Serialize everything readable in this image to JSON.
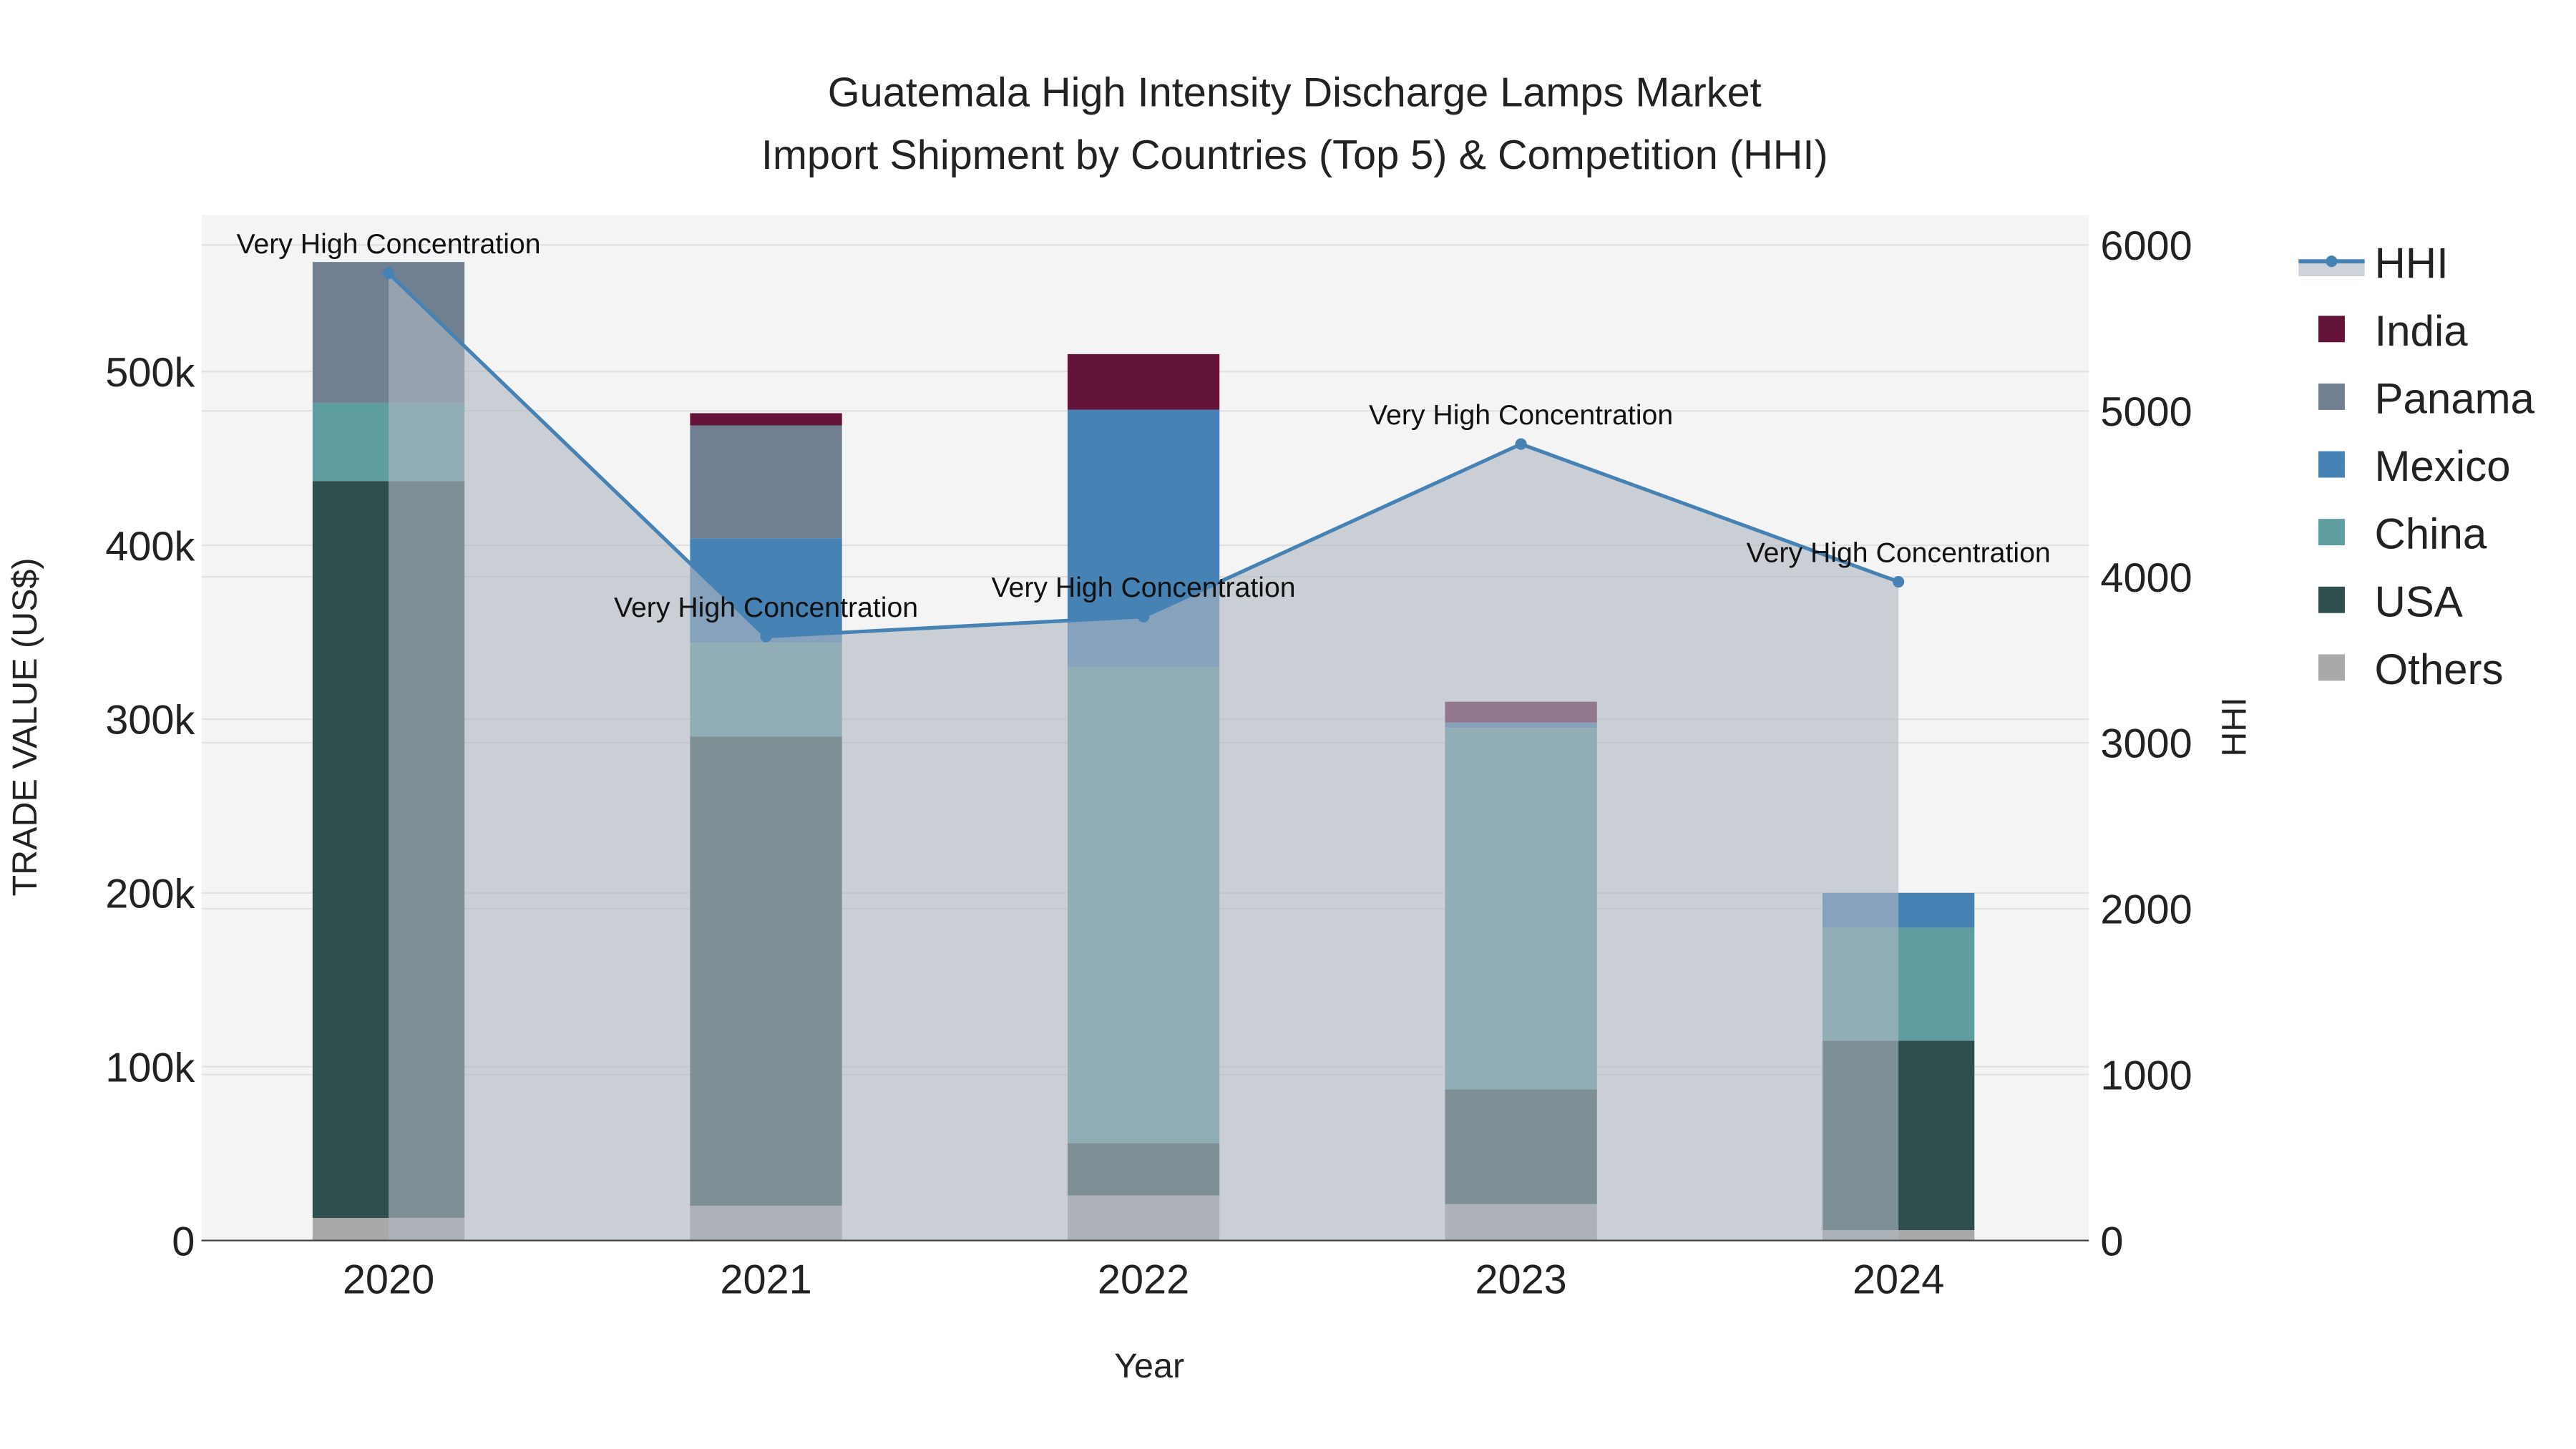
{
  "chart_data": {
    "type": "bar",
    "title_line1": "Guatemala High Intensity Discharge Lamps Market",
    "title_line2": "Import Shipment by Countries (Top 5) & Competition (HHI)",
    "xlabel": "Year",
    "ylabel": "TRADE VALUE (US$)",
    "y2label": "HHI",
    "categories": [
      "2020",
      "2021",
      "2022",
      "2023",
      "2024"
    ],
    "ylim": [
      0,
      590000
    ],
    "y2lim": [
      0,
      6180
    ],
    "yticks": [
      {
        "v": 0,
        "label": "0"
      },
      {
        "v": 100000,
        "label": "100k"
      },
      {
        "v": 200000,
        "label": "200k"
      },
      {
        "v": 300000,
        "label": "300k"
      },
      {
        "v": 400000,
        "label": "400k"
      },
      {
        "v": 500000,
        "label": "500k"
      }
    ],
    "y2ticks": [
      {
        "v": 0,
        "label": "0"
      },
      {
        "v": 1000,
        "label": "1000"
      },
      {
        "v": 2000,
        "label": "2000"
      },
      {
        "v": 3000,
        "label": "3000"
      },
      {
        "v": 4000,
        "label": "4000"
      },
      {
        "v": 5000,
        "label": "5000"
      },
      {
        "v": 6000,
        "label": "6000"
      }
    ],
    "series": [
      {
        "name": "Others",
        "color": "#a9a9a9",
        "values": [
          13000,
          20000,
          26000,
          21000,
          6000
        ]
      },
      {
        "name": "USA",
        "color": "#2f4f4f",
        "values": [
          424000,
          270000,
          30000,
          66000,
          109000
        ]
      },
      {
        "name": "China",
        "color": "#5f9ea0",
        "values": [
          45000,
          54000,
          274000,
          208000,
          65000
        ]
      },
      {
        "name": "Mexico",
        "color": "#4682b4",
        "values": [
          0,
          60000,
          148000,
          3000,
          20000
        ]
      },
      {
        "name": "Panama",
        "color": "#708090",
        "values": [
          81000,
          65000,
          0,
          0,
          0
        ]
      },
      {
        "name": "India",
        "color": "#641438",
        "values": [
          0,
          7000,
          32000,
          12000,
          0
        ]
      }
    ],
    "hhi": {
      "name": "HHI",
      "color": "#4682b4",
      "values": [
        5830,
        3640,
        3760,
        4800,
        3970
      ],
      "annotations": [
        "Very High Concentration",
        "Very High Concentration",
        "Very High Concentration",
        "Very High Concentration",
        "Very High Concentration"
      ]
    },
    "legend_order": [
      "HHI",
      "India",
      "Panama",
      "Mexico",
      "China",
      "USA",
      "Others"
    ],
    "legend_position": "right"
  }
}
